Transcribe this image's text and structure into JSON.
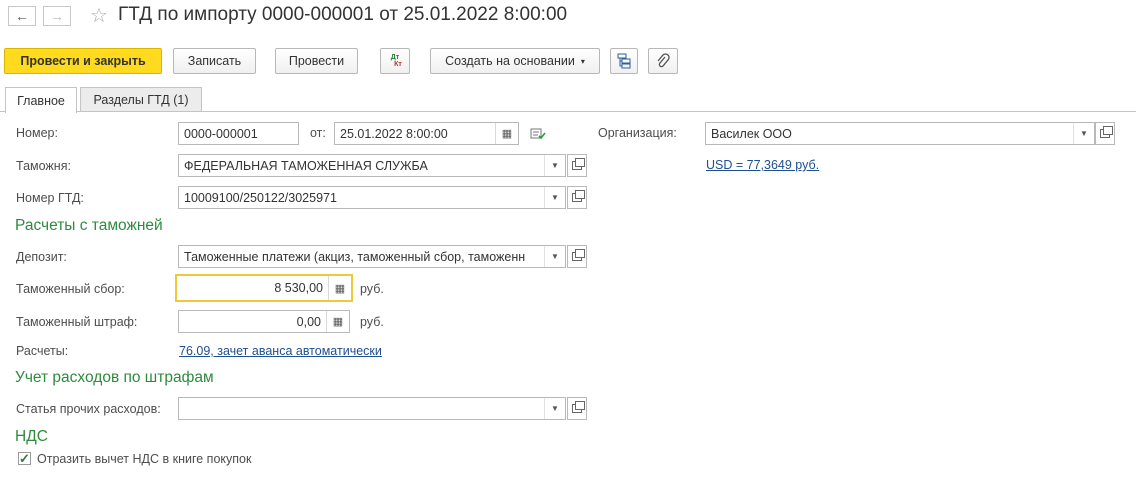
{
  "header": {
    "back_icon": "arrow-left-icon",
    "forward_icon": "arrow-right-icon",
    "favorite_icon": "star-icon",
    "title": "ГТД по импорту 0000-000001 от 25.01.2022 8:00:00"
  },
  "toolbar": {
    "post_close_label": "Провести и закрыть",
    "save_label": "Записать",
    "post_label": "Провести",
    "dtkt_label_top": "Дт",
    "dtkt_label_bottom": "Кт",
    "create_based_label": "Создать на основании",
    "structure_icon": "structure-icon",
    "attach_icon": "paperclip-icon"
  },
  "tabs": [
    {
      "label": "Главное",
      "active": true
    },
    {
      "label": "Разделы ГТД (1)",
      "active": false
    }
  ],
  "form": {
    "number_label": "Номер:",
    "number_value": "0000-000001",
    "from_label": "от:",
    "date_value": "25.01.2022  8:00:00",
    "org_label": "Организация:",
    "org_value": "Василек ООО",
    "currency_link": "USD = 77,3649 руб.",
    "customs_label": "Таможня:",
    "customs_value": "ФЕДЕРАЛЬНАЯ ТАМОЖЕННАЯ СЛУЖБА",
    "gtd_number_label": "Номер ГТД:",
    "gtd_number_value": "10009100/250122/3025971",
    "section_customs": "Расчеты с таможней",
    "deposit_label": "Депозит:",
    "deposit_value": "Таможенные платежи (акциз, таможенный сбор, таможенн",
    "fee_label": "Таможенный сбор:",
    "fee_value": "8 530,00",
    "fee_unit": "руб.",
    "fine_label": "Таможенный штраф:",
    "fine_value": "0,00",
    "fine_unit": "руб.",
    "settlements_label": "Расчеты:",
    "settlements_link": "76.09, зачет аванса автоматически",
    "section_fines": "Учет расходов по штрафам",
    "expense_label": "Статья прочих расходов:",
    "expense_value": "",
    "section_vat": "НДС",
    "vat_checkbox_label": "Отразить вычет НДС в книге покупок",
    "vat_checked": true
  },
  "colors": {
    "primary_button": "#ffda1f",
    "section_heading": "#2e8b3d",
    "link": "#1d4f91",
    "focus_border": "#f0c93a"
  }
}
